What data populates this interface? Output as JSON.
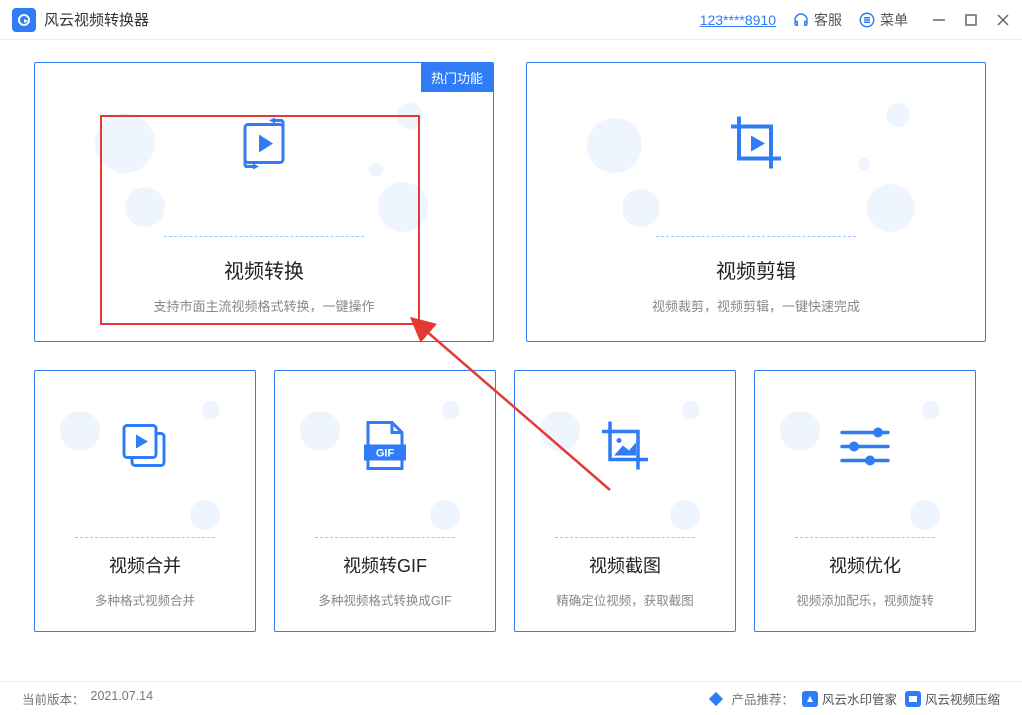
{
  "titlebar": {
    "app_name": "风云视频转换器",
    "user_id": "123****8910",
    "customer_service": "客服",
    "menu": "菜单"
  },
  "cards": {
    "hot_tag": "热门功能",
    "convert": {
      "title": "视频转换",
      "desc": "支持市面主流视频格式转换，一键操作"
    },
    "edit": {
      "title": "视频剪辑",
      "desc": "视频裁剪，视频剪辑，一键快速完成"
    },
    "merge": {
      "title": "视频合并",
      "desc": "多种格式视频合并"
    },
    "gif": {
      "title": "视频转GIF",
      "desc": "多种视频格式转换成GIF"
    },
    "screenshot": {
      "title": "视频截图",
      "desc": "精确定位视频，获取截图"
    },
    "optimize": {
      "title": "视频优化",
      "desc": "视频添加配乐，视频旋转"
    },
    "gif_badge": "GIF"
  },
  "footer": {
    "version_label": "当前版本：",
    "version": "2021.07.14",
    "recommend_label": "产品推荐：",
    "app1": "风云水印管家",
    "app2": "风云视频压缩"
  }
}
